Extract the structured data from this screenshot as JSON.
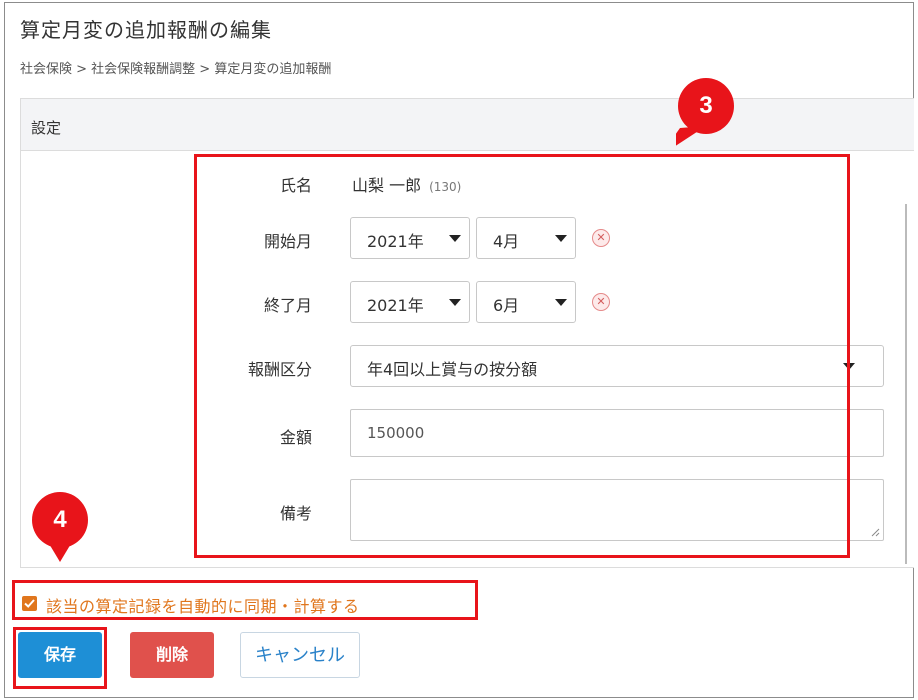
{
  "page": {
    "title": "算定月変の追加報酬の編集",
    "breadcrumb": "社会保険 > 社会保険報酬調整 > 算定月変の追加報酬"
  },
  "panel": {
    "header": "設定"
  },
  "form": {
    "name_label": "氏名",
    "name_value": "山梨 一郎",
    "name_id": "(130)",
    "start_label": "開始月",
    "start_year": "2021年",
    "start_month": "4月",
    "end_label": "終了月",
    "end_year": "2021年",
    "end_month": "6月",
    "type_label": "報酬区分",
    "type_value": "年4回以上賞与の按分額",
    "amount_label": "金額",
    "amount_value": "150000",
    "note_label": "備考",
    "note_value": ""
  },
  "sync": {
    "checked": true,
    "label": "該当の算定記録を自動的に同期・計算する"
  },
  "buttons": {
    "save": "保存",
    "delete": "削除",
    "cancel": "キャンセル"
  },
  "annotations": {
    "badge_3": "3",
    "badge_4": "4"
  },
  "colors": {
    "accent_orange": "#e0761d",
    "save_blue": "#1e8fd6",
    "delete_red": "#e0514c",
    "annotation_red": "#e8141a"
  }
}
